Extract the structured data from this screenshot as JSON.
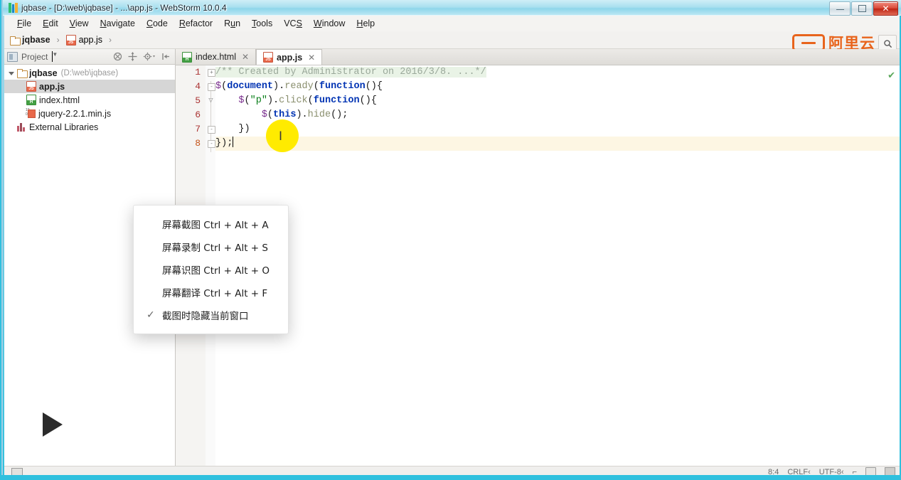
{
  "window": {
    "title": "jqbase - [D:\\web\\jqbase] - ...\\app.js - WebStorm 10.0.4",
    "minimize_label": "▬",
    "maximize_label": "❐",
    "close_label": "✕"
  },
  "menubar": {
    "items": [
      {
        "pre": "",
        "mn": "F",
        "post": "ile"
      },
      {
        "pre": "",
        "mn": "E",
        "post": "dit"
      },
      {
        "pre": "",
        "mn": "V",
        "post": "iew"
      },
      {
        "pre": "",
        "mn": "N",
        "post": "avigate"
      },
      {
        "pre": "",
        "mn": "C",
        "post": "ode"
      },
      {
        "pre": "",
        "mn": "R",
        "post": "efactor"
      },
      {
        "pre": "R",
        "mn": "u",
        "post": "n"
      },
      {
        "pre": "",
        "mn": "T",
        "post": "ools"
      },
      {
        "pre": "VC",
        "mn": "S",
        "post": ""
      },
      {
        "pre": "",
        "mn": "W",
        "post": "indow"
      },
      {
        "pre": "",
        "mn": "H",
        "post": "elp"
      }
    ]
  },
  "breadcrumb": {
    "project": "jqbase",
    "separator": "›",
    "file": "app.js"
  },
  "branding": {
    "name": "阿里云",
    "accent": "#e8641c",
    "search_icon": "search-icon"
  },
  "project_panel": {
    "title": "Project",
    "toolbar": [
      "collapse-all-icon",
      "locate-icon",
      "settings-icon",
      "hide-icon"
    ],
    "tree": [
      {
        "label": "jqbase",
        "path": "(D:\\web\\jqbase)",
        "icon": "folder-icon",
        "level": 0,
        "selected": false,
        "expanded": true
      },
      {
        "label": "app.js",
        "path": "",
        "icon": "js-file-icon",
        "level": 1,
        "selected": true,
        "expanded": false
      },
      {
        "label": "index.html",
        "path": "",
        "icon": "html-file-icon",
        "level": 1,
        "selected": false,
        "expanded": false
      },
      {
        "label": "jquery-2.2.1.min.js",
        "path": "",
        "icon": "minjs-file-icon",
        "level": 1,
        "selected": false,
        "expanded": false
      },
      {
        "label": "External Libraries",
        "path": "",
        "icon": "library-icon",
        "level": 0,
        "selected": false,
        "expanded": false
      }
    ]
  },
  "editor": {
    "tabs": [
      {
        "label": "index.html",
        "icon": "html-file-icon",
        "active": false,
        "close": "✕"
      },
      {
        "label": "app.js",
        "icon": "js-file-icon",
        "active": true,
        "close": "✕"
      }
    ],
    "line_numbers": [
      "1",
      "4",
      "5",
      "6",
      "7",
      "8"
    ],
    "current_line_index": 5,
    "inspection_status": "✔",
    "code": [
      {
        "num": "1",
        "text": "/** Created by Administrator on 2016/3/8. ...*/",
        "fold": "+"
      },
      {
        "num": "4",
        "text": "$(document).ready(function(){",
        "fold": "-"
      },
      {
        "num": "5",
        "text": "    $(\"p\").click(function(){",
        "fold": "-"
      },
      {
        "num": "6",
        "text": "        $(this).hide();",
        "fold": ""
      },
      {
        "num": "7",
        "text": "    })",
        "fold": "-"
      },
      {
        "num": "8",
        "text": "});",
        "fold": "-"
      }
    ]
  },
  "context_menu": {
    "items": [
      {
        "label": "屏幕截图 Ctrl + Alt + A",
        "checked": false
      },
      {
        "label": "屏幕录制 Ctrl + Alt + S",
        "checked": false
      },
      {
        "label": "屏幕识图 Ctrl + Alt + O",
        "checked": false
      },
      {
        "label": "屏幕翻译 Ctrl + Alt + F",
        "checked": false
      },
      {
        "label": "截图时隐藏当前窗口",
        "checked": true
      }
    ],
    "check_glyph": "✓"
  },
  "overlay": {
    "play_button": "play-icon",
    "cursor_highlight_color": "#ffeb00",
    "cursor_glyph": "I"
  },
  "statusbar": {
    "position": "8:4",
    "line_sep": "CRLF‹",
    "encoding": "UTF-8‹",
    "lock_icon": "lock-icon",
    "memory_icon": "memory-icon",
    "resize_icon": "resize-icon"
  }
}
